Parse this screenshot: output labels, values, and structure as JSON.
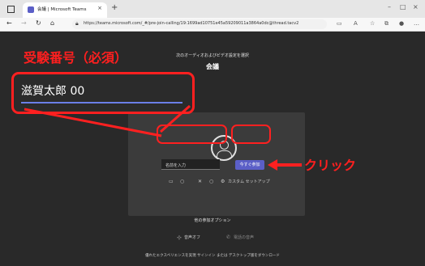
{
  "browser": {
    "tab_title": "会議 | Microsoft Teams",
    "new_tab": "+",
    "close_tab": "×",
    "url": "https://teams.microsoft.com/_#/pre-join-calling/19:1699ad10751e45a59209011a3864a0dc@thread.tacv2",
    "window_controls": [
      "–",
      "□",
      "×"
    ]
  },
  "teams": {
    "subtitle": "次のオーディオおよびビデオ設定を選択",
    "meeting_title": "会議",
    "name_placeholder": "名前を入力",
    "join_button": "今すぐ参加",
    "custom_setup": "カスタム セットアップ",
    "other_options": "他の参加オプション",
    "audio_off": "音声オフ",
    "phone_audio": "電話の音声",
    "footer": "優れたエクスペリエンスを実現 サインイン または デスクトップ版をダウンロード"
  },
  "annotations": {
    "title": "受験番号（必須）",
    "name_example": "滋賀太郎 00",
    "click_label": "クリック",
    "accent_color": "#ff2020"
  }
}
